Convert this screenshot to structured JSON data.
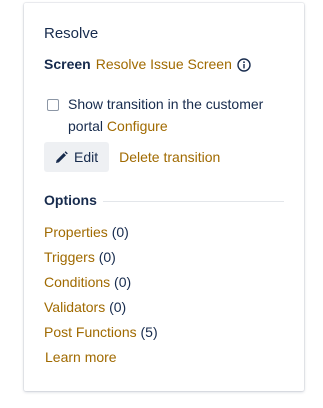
{
  "panel": {
    "title": "Resolve",
    "screen": {
      "label": "Screen",
      "value": "Resolve Issue Screen",
      "info_icon": "info-icon"
    },
    "customer_portal": {
      "checked": false,
      "text": "Show transition in the customer portal",
      "link": "Configure"
    },
    "actions": {
      "edit_label": "Edit",
      "edit_icon": "pencil-icon",
      "delete_label": "Delete transition"
    },
    "options": {
      "heading": "Options",
      "items": [
        {
          "label": "Properties",
          "count": "(0)"
        },
        {
          "label": "Triggers",
          "count": "(0)"
        },
        {
          "label": "Conditions",
          "count": "(0)"
        },
        {
          "label": "Validators",
          "count": "(0)"
        },
        {
          "label": "Post Functions",
          "count": "(5)"
        }
      ]
    },
    "learn_more": "Learn more"
  },
  "colors": {
    "link": "#a06a00",
    "text": "#172b4d",
    "button_bg": "#eef0f3"
  }
}
